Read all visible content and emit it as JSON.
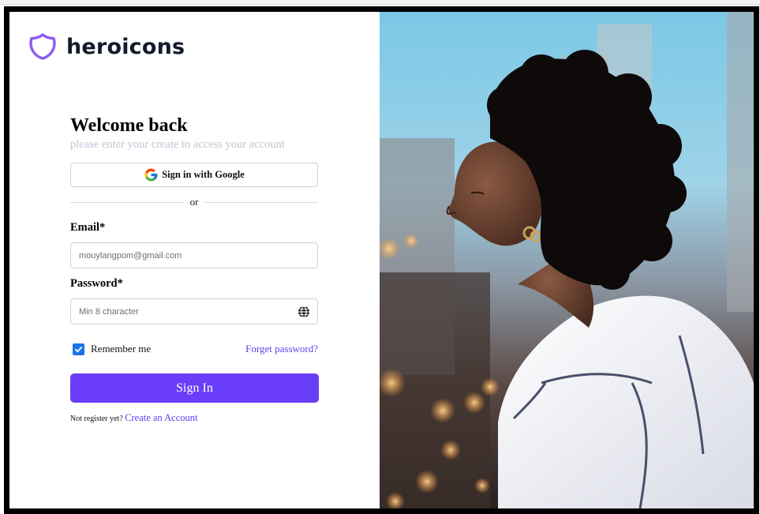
{
  "brand": {
    "name": "heroicons",
    "logo_icon": "shield-icon",
    "accent": "#8b5cf6"
  },
  "form": {
    "title": "Welcome back",
    "subtitle": "please enter your create to access your account",
    "google_button": "Sign in with Google",
    "divider_text": "or",
    "email": {
      "label": "Email*",
      "placeholder": "mouylangpom@gmail.com",
      "value": ""
    },
    "password": {
      "label": "Password*",
      "placeholder": "Min 8 character",
      "value": "",
      "toggle_icon": "globe-icon"
    },
    "remember_me": {
      "label": "Remember me",
      "checked": true
    },
    "forgot_link": "Forget password?",
    "submit": "Sign In",
    "register": {
      "prompt": "Not register yet?",
      "link": "Create an Account"
    }
  },
  "hero": {
    "image": "woman-with-curly-hair-city-evening"
  },
  "colors": {
    "primary": "#6a3df8",
    "link": "#5b3df5",
    "checkbox": "#1a73e8"
  }
}
